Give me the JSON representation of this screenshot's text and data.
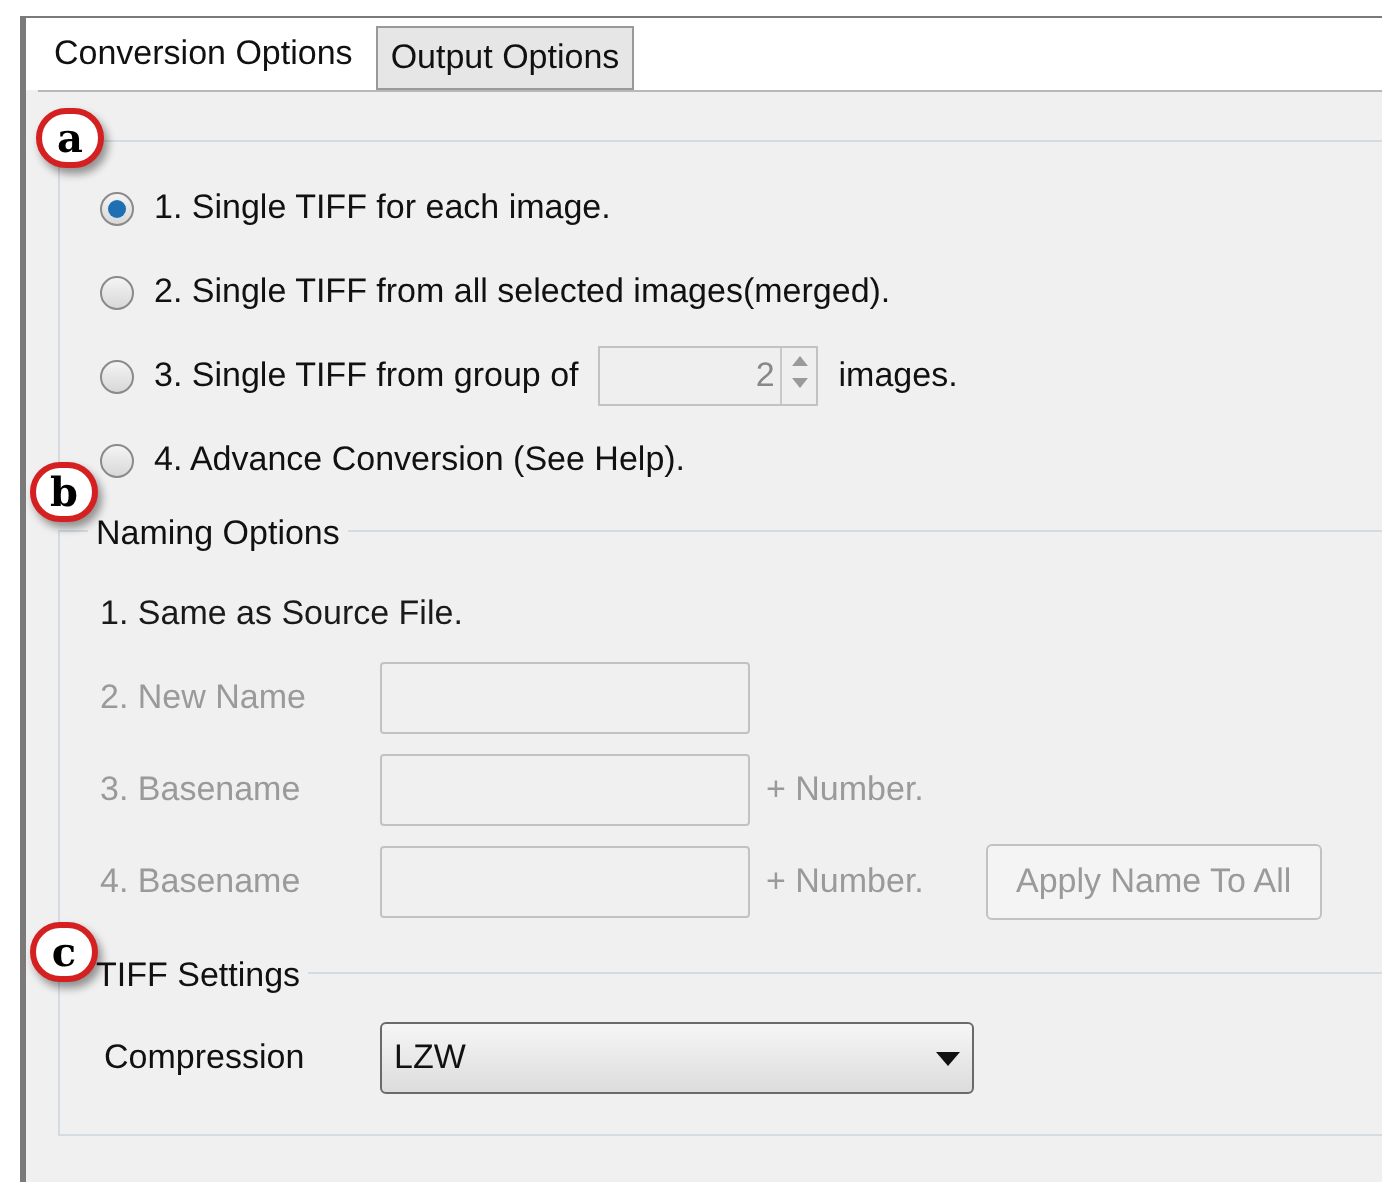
{
  "tabs": [
    {
      "label": "Conversion Options",
      "selected": true
    },
    {
      "label": "Output Options",
      "selected": false
    }
  ],
  "callouts": [
    "a",
    "b",
    "c"
  ],
  "conversion": {
    "options": [
      {
        "kind": "plain",
        "label": "1. Single TIFF for each image.",
        "selected": true
      },
      {
        "kind": "plain",
        "label": "2. Single TIFF from all selected images(merged).",
        "selected": false
      },
      {
        "kind": "spinner",
        "label": "3. Single TIFF from group of",
        "value": "2",
        "suffix": "images.",
        "selected": false
      },
      {
        "kind": "plain",
        "label": "4. Advance Conversion (See Help).",
        "selected": false
      }
    ]
  },
  "naming": {
    "title": "Naming Options",
    "rows": [
      {
        "kind": "text",
        "label": "1. Same as Source File.",
        "disabled": false
      },
      {
        "kind": "field",
        "label": "2. New Name",
        "disabled": true
      },
      {
        "kind": "field",
        "label": "3. Basename",
        "suffix": "+ Number.",
        "disabled": true
      },
      {
        "kind": "field",
        "label": "4. Basename",
        "suffix": "+ Number.",
        "button": "Apply Name To All",
        "disabled": true
      }
    ]
  },
  "tiff": {
    "title": "TIFF Settings",
    "label": "Compression",
    "value": "LZW"
  }
}
